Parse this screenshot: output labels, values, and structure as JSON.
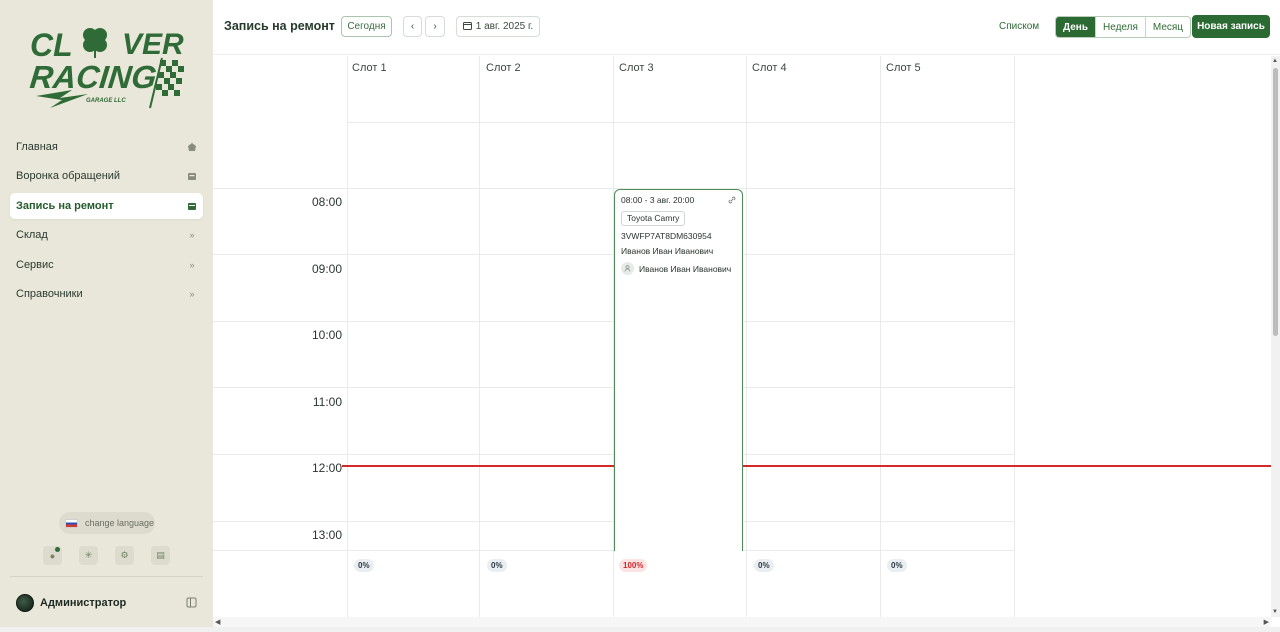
{
  "brand": {
    "logo_line1": "CL",
    "logo_line1b": "VER",
    "logo_line2": "RACING",
    "logo_sub": "GARAGE LLC"
  },
  "sidebar": {
    "items": [
      {
        "label": "Главная",
        "icon": "home-icon"
      },
      {
        "label": "Воронка обращений",
        "icon": "inbox-icon"
      },
      {
        "label": "Запись на ремонт",
        "icon": "calendar-icon",
        "active": true
      },
      {
        "label": "Склад",
        "icon": "chevron-right-icon"
      },
      {
        "label": "Сервис",
        "icon": "chevron-right-icon"
      },
      {
        "label": "Справочники",
        "icon": "chevron-right-icon"
      }
    ],
    "language_button": "change language",
    "user_name": "Администратор"
  },
  "topbar": {
    "title": "Запись на ремонт",
    "today": "Сегодня",
    "date": "1 авг. 2025 г.",
    "list_view": "Списком",
    "views": [
      "День",
      "Неделя",
      "Месяц"
    ],
    "active_view": "День",
    "new_entry": "Новая запись"
  },
  "calendar": {
    "slots": [
      "Слот 1",
      "Слот 2",
      "Слот 3",
      "Слот 4",
      "Слот 5"
    ],
    "hours": [
      "08:00",
      "09:00",
      "10:00",
      "11:00",
      "12:00",
      "13:00"
    ],
    "loads": [
      "0%",
      "0%",
      "100%",
      "0%",
      "0%"
    ],
    "event": {
      "time_range": "08:00 - 3 авг. 20:00",
      "car": "Toyota Camry",
      "vin": "3VWFP7AT8DM630954",
      "owner": "Иванов Иван Иванович",
      "assignee": "Иванов Иван Иванович"
    }
  },
  "colors": {
    "accent": "#2b6a33",
    "sidebar_bg": "#e8e7d9",
    "now_line": "#d22a2a"
  }
}
